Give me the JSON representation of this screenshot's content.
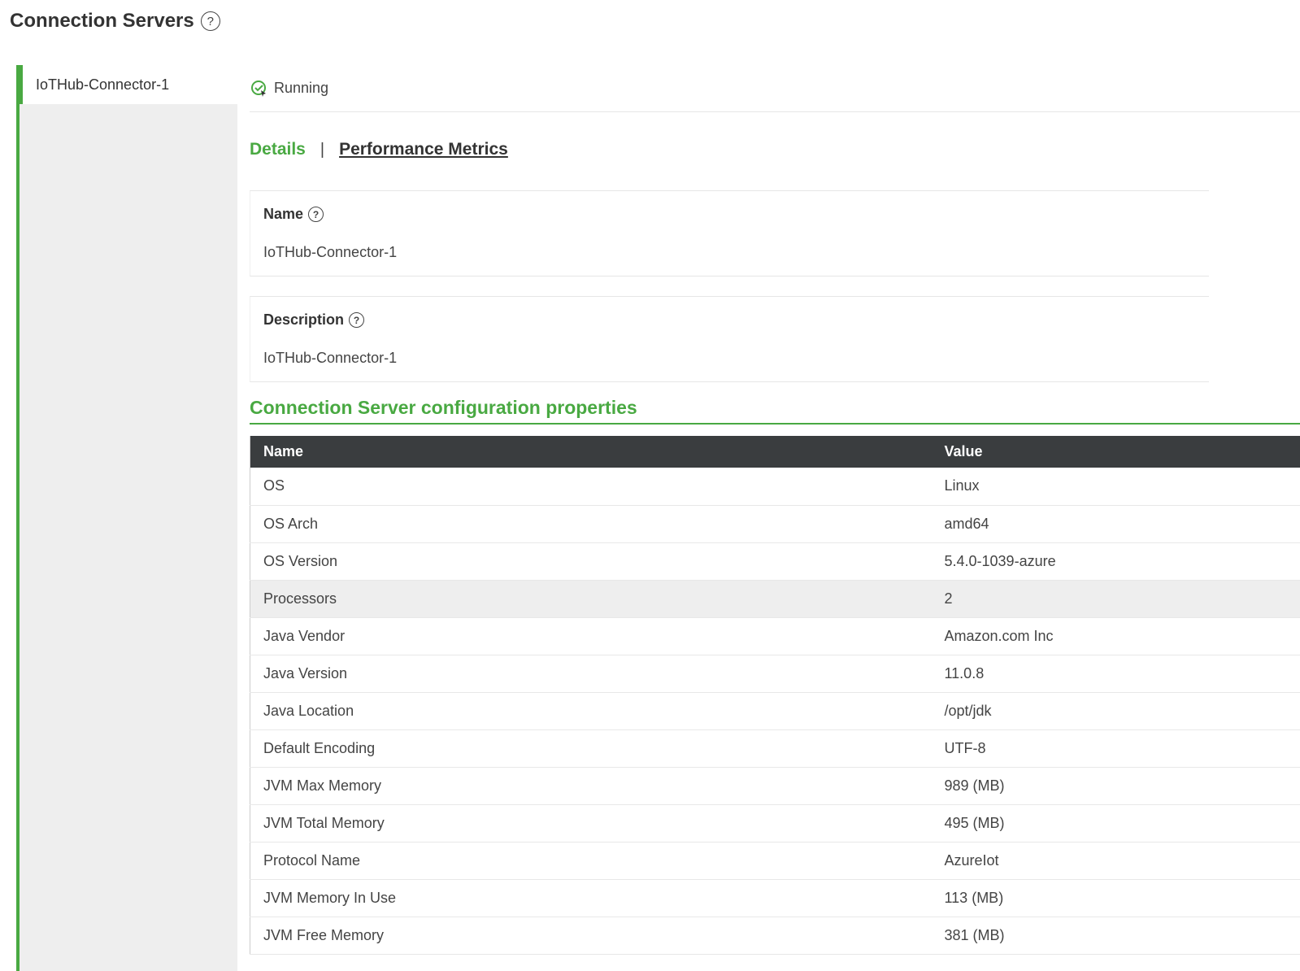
{
  "header": {
    "title": "Connection Servers"
  },
  "sidebar": {
    "items": [
      {
        "label": "IoTHub-Connector-1"
      }
    ]
  },
  "status": {
    "text": "Running",
    "icon": "check-circle-icon",
    "color": "#49a942"
  },
  "tabs": {
    "details": "Details",
    "separator": "|",
    "performance": "Performance Metrics"
  },
  "details": {
    "name_label": "Name",
    "name_value": "IoTHub-Connector-1",
    "description_label": "Description",
    "description_value": "IoTHub-Connector-1"
  },
  "config": {
    "title": "Connection Server configuration properties",
    "columns": [
      "Name",
      "Value"
    ],
    "rows": [
      [
        "OS",
        "Linux"
      ],
      [
        "OS Arch",
        "amd64"
      ],
      [
        "OS Version",
        "5.4.0-1039-azure"
      ],
      [
        "Processors",
        "2"
      ],
      [
        "Java Vendor",
        "Amazon.com Inc"
      ],
      [
        "Java Version",
        "11.0.8"
      ],
      [
        "Java Location",
        "/opt/jdk"
      ],
      [
        "Default Encoding",
        "UTF-8"
      ],
      [
        "JVM Max Memory",
        "989 (MB)"
      ],
      [
        "JVM Total Memory",
        "495 (MB)"
      ],
      [
        "Protocol Name",
        "AzureIot"
      ],
      [
        "JVM Memory In Use",
        "113 (MB)"
      ],
      [
        "JVM Free Memory",
        "381 (MB)"
      ]
    ]
  },
  "colors": {
    "accent": "#49a942",
    "table_header": "#3a3d3f",
    "sidebar_bg": "#eeeeee"
  }
}
